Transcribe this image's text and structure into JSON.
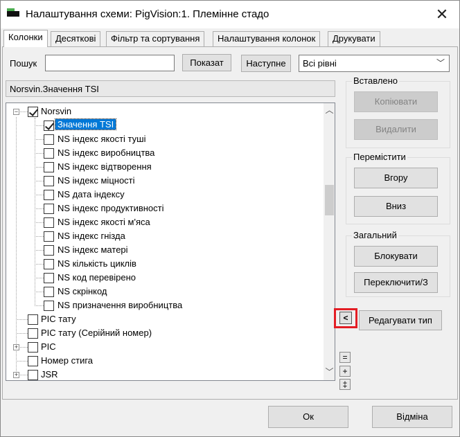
{
  "window": {
    "title": "Налаштування схеми: PigVision:1. Племінне стадо",
    "close_glyph": "✕"
  },
  "tabs": [
    {
      "label": "Колонки",
      "active": true
    },
    {
      "label": "Десяткові",
      "active": false
    },
    {
      "label": "Фільтр та сортування",
      "active": false
    },
    {
      "label": "Налаштування колонок",
      "active": false
    },
    {
      "label": "Друкувати",
      "active": false
    }
  ],
  "search": {
    "label": "Пошук",
    "value": "",
    "show_button": "Показат",
    "next_button": "Наступне",
    "level_select": "Всі рівні"
  },
  "path": "Norsvin.Значення TSI",
  "tree": {
    "root": {
      "label": "Norsvin",
      "checked": true,
      "expanded": true
    },
    "children": [
      {
        "label": "Значення TSI",
        "checked": true,
        "selected": true
      },
      {
        "label": "NS індекс якості туші",
        "checked": false
      },
      {
        "label": "NS індекс виробництва",
        "checked": false
      },
      {
        "label": "NS індекс відтворення",
        "checked": false
      },
      {
        "label": "NS індекс міцності",
        "checked": false
      },
      {
        "label": "NS дата індексу",
        "checked": false
      },
      {
        "label": "NS індекс продуктивності",
        "checked": false
      },
      {
        "label": "NS індекс якості м'яса",
        "checked": false
      },
      {
        "label": "NS індекс гнізда",
        "checked": false
      },
      {
        "label": "NS індекс матері",
        "checked": false
      },
      {
        "label": "NS кількість циклів",
        "checked": false
      },
      {
        "label": "NS код перевірено",
        "checked": false
      },
      {
        "label": "NS скрінкод",
        "checked": false
      },
      {
        "label": "NS призначення виробництва",
        "checked": false
      }
    ],
    "siblings": [
      {
        "label": "PIC тату",
        "checked": false,
        "expandable": false
      },
      {
        "label": "PIC тату (Серійний номер)",
        "checked": false,
        "expandable": false
      },
      {
        "label": "PIC",
        "checked": false,
        "expandable": true
      },
      {
        "label": "Номер стига",
        "checked": false,
        "expandable": false
      },
      {
        "label": "JSR",
        "checked": false,
        "expandable": true
      }
    ],
    "expand_glyph": "+",
    "collapse_glyph": "−"
  },
  "inserted_group": {
    "title": "Вставлено",
    "copy_button": "Копіювати",
    "delete_button": "Видалити"
  },
  "move_group": {
    "title": "Перемістити",
    "up_button": "Вгору",
    "down_button": "Вниз"
  },
  "general_group": {
    "title": "Загальний",
    "block_button": "Блокувати",
    "toggle_button": "Переключити/З"
  },
  "edit_type_button": "Редагувати тип",
  "collapse_glyph": "<",
  "small_buttons": [
    "=",
    "+",
    "‡"
  ],
  "footer": {
    "ok_button": "Ок",
    "cancel_button": "Відміна"
  },
  "colors": {
    "selection": "#0078d7",
    "highlight": "#e31d24"
  }
}
